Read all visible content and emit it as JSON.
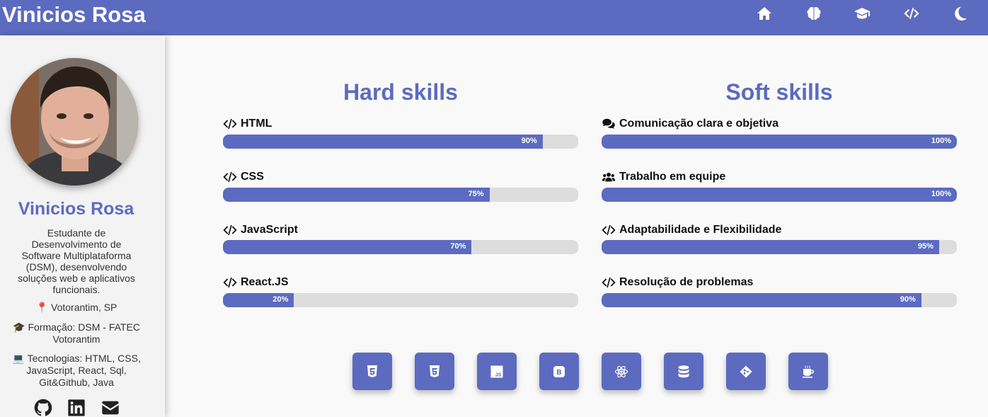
{
  "header": {
    "brand": "Vinicios Rosa",
    "nav_icons": [
      "home-icon",
      "brain-icon",
      "graduation-cap-icon",
      "code-icon",
      "moon-icon"
    ]
  },
  "sidebar": {
    "name": "Vinicios Rosa",
    "bio": "Estudante de Desenvolvimento de Software Multiplataforma (DSM), desenvolvendo soluções web e aplicativos funcionais.",
    "location": "Votorantim, SP",
    "education": "Formação: DSM - FATEC Votorantim",
    "technologies": "Tecnologias: HTML, CSS, JavaScript, React, Sql, Git&Github, Java",
    "social_icons": [
      "github-icon",
      "linkedin-icon",
      "email-icon"
    ]
  },
  "hard_skills": {
    "title": "Hard skills",
    "items": [
      {
        "label": "HTML",
        "percent": 90,
        "percent_label": "90%"
      },
      {
        "label": "CSS",
        "percent": 75,
        "percent_label": "75%"
      },
      {
        "label": "JavaScript",
        "percent": 70,
        "percent_label": "70%"
      },
      {
        "label": "React.JS",
        "percent": 20,
        "percent_label": "20%"
      }
    ]
  },
  "soft_skills": {
    "title": "Soft skills",
    "items": [
      {
        "label": "Comunicação clara e objetiva",
        "icon": "comments-icon",
        "percent": 100,
        "percent_label": "100%"
      },
      {
        "label": "Trabalho em equipe",
        "icon": "users-icon",
        "percent": 100,
        "percent_label": "100%"
      },
      {
        "label": "Adaptabilidade e Flexibilidade",
        "icon": "code-icon",
        "percent": 95,
        "percent_label": "95%"
      },
      {
        "label": "Resolução de problemas",
        "icon": "code-icon",
        "percent": 90,
        "percent_label": "90%"
      }
    ]
  },
  "tech_buttons": [
    {
      "icon": "html5-icon"
    },
    {
      "icon": "css3-icon"
    },
    {
      "icon": "javascript-icon",
      "text": "JS"
    },
    {
      "icon": "bootstrap-icon",
      "text": "B"
    },
    {
      "icon": "react-icon"
    },
    {
      "icon": "database-icon"
    },
    {
      "icon": "git-icon"
    },
    {
      "icon": "java-icon"
    }
  ],
  "colors": {
    "accent": "#5c6bc0",
    "track": "#dddddd",
    "background": "#f9f9f9",
    "sidebar": "#f3f3f3"
  }
}
